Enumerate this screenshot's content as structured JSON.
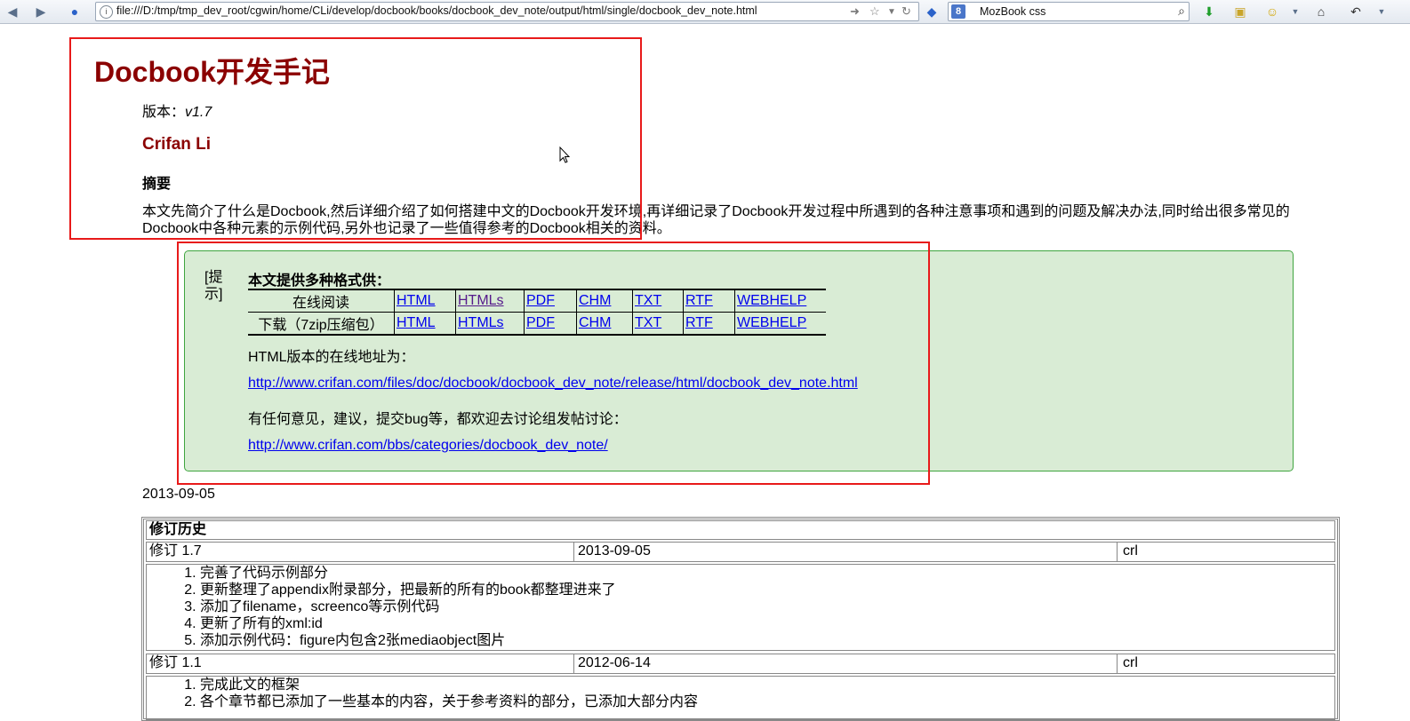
{
  "browser": {
    "url": "file:///D:/tmp/tmp_dev_root/cgwin/home/CLi/develop/docbook/books/docbook_dev_note/output/html/single/docbook_dev_note.html",
    "search_text": "MozBook  css",
    "search_engine_letter": "8"
  },
  "doc": {
    "title": "Docbook开发手记",
    "version_label": "版本：",
    "version_number": "v1.7",
    "author": "Crifan Li",
    "abstract_title": "摘要",
    "abstract_text": "本文先简介了什么是Docbook,然后详细介绍了如何搭建中文的Docbook开发环境,再详细记录了Docbook开发过程中所遇到的各种注意事项和遇到的问题及解决办法,同时给出很多常见的Docbook中各种元素的示例代码,另外也记录了一些值得参考的Docbook相关的资料。",
    "date": "2013-09-05"
  },
  "tip": {
    "label": "[提示]",
    "heading": "本文提供多种格式供：",
    "rows": [
      {
        "label": "在线阅读",
        "links": [
          "HTML",
          "HTMLs",
          "PDF",
          "CHM",
          "TXT",
          "RTF",
          "WEBHELP"
        ]
      },
      {
        "label": "下载（7zip压缩包）",
        "links": [
          "HTML",
          "HTMLs",
          "PDF",
          "CHM",
          "TXT",
          "RTF",
          "WEBHELP"
        ]
      }
    ],
    "online_text": "HTML版本的在线地址为：",
    "online_url": "http://www.crifan.com/files/doc/docbook/docbook_dev_note/release/html/docbook_dev_note.html",
    "feedback_text": "有任何意见，建议，提交bug等，都欢迎去讨论组发帖讨论：",
    "feedback_url": "http://www.crifan.com/bbs/categories/docbook_dev_note/"
  },
  "revisions": {
    "title": "修订历史",
    "entries": [
      {
        "version": "修订 1.7",
        "date": "2013-09-05",
        "author": "crl",
        "items": [
          "完善了代码示例部分",
          "更新整理了appendix附录部分，把最新的所有的book都整理进来了",
          "添加了filename，screenco等示例代码",
          "更新了所有的xml:id",
          "添加示例代码：figure内包含2张mediaobject图片"
        ]
      },
      {
        "version": "修订 1.1",
        "date": "2012-06-14",
        "author": "crl",
        "items": [
          "完成此文的框架",
          "各个章节都已添加了一些基本的内容，关于参考资料的部分，已添加大部分内容"
        ]
      }
    ]
  },
  "colors": {
    "title": "#8b0000",
    "tip_bg": "#d9ecd5",
    "tip_border": "#3fa53f",
    "highlight": "#e81a1a",
    "link": "#0000ee"
  }
}
